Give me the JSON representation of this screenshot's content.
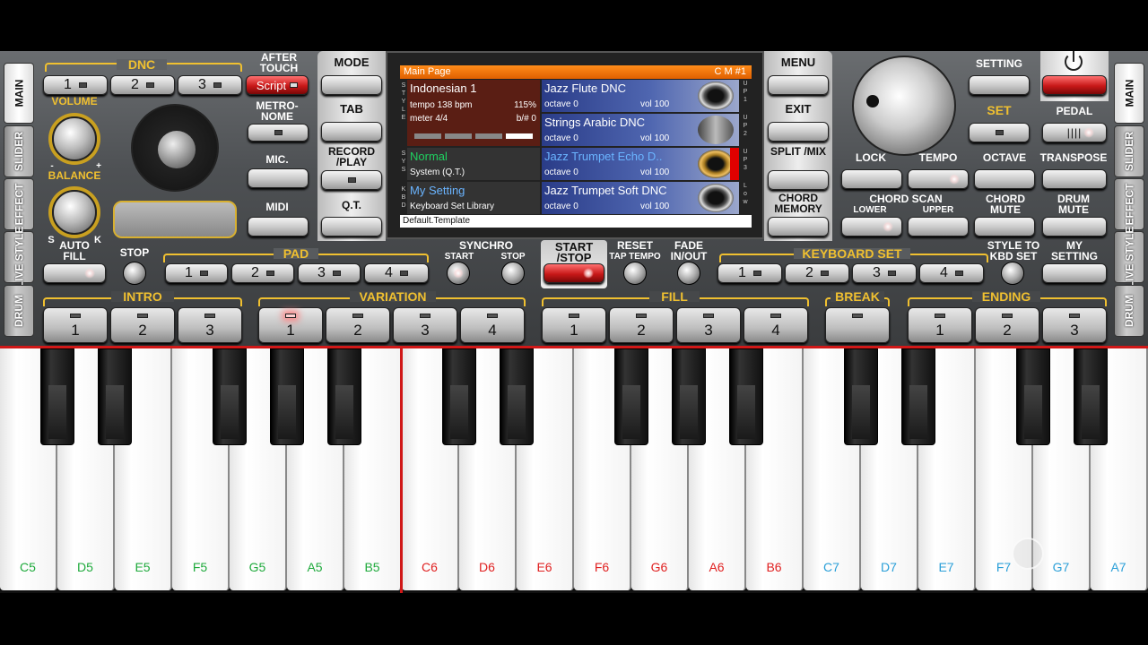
{
  "side_tabs": [
    "MAIN",
    "SLIDER",
    "EFFECT",
    "LIVE STYLE",
    "DRUM"
  ],
  "left": {
    "dnc_label": "DNC",
    "dnc_buttons": [
      "1",
      "2",
      "3"
    ],
    "after_touch": "AFTER TOUCH",
    "script_label": "Script",
    "volume": "VOLUME",
    "balance": "BALANCE",
    "balance_minus": "-",
    "balance_plus": "+",
    "s_label": "S",
    "k_label": "K",
    "metronome": "METRO- NOME",
    "mic": "MIC.",
    "midi": "MIDI",
    "auto_fill": "AUTO FILL",
    "stop": "STOP",
    "pad": "PAD",
    "pad_buttons": [
      "1",
      "2",
      "3",
      "4"
    ],
    "intro": "INTRO",
    "intro_buttons": [
      "1",
      "2",
      "3"
    ],
    "variation": "VARIATION",
    "variation_buttons": [
      "1",
      "2",
      "3",
      "4"
    ]
  },
  "center": {
    "mode": "MODE",
    "tab": "TAB",
    "record_play": "RECORD /PLAY",
    "qt": "Q.T.",
    "menu": "MENU",
    "exit": "EXIT",
    "split_mix": "SPLIT /MIX",
    "chord_memory": "CHORD MEMORY",
    "synchro": "SYNCHRO",
    "synchro_start": "START",
    "synchro_stop": "STOP",
    "start_stop": "START /STOP",
    "reset": "RESET",
    "tap_tempo": "TAP TEMPO",
    "fade": "FADE IN/OUT",
    "fill": "FILL",
    "fill_buttons": [
      "1",
      "2",
      "3",
      "4"
    ],
    "break": "BREAK"
  },
  "screen": {
    "title": "Main Page",
    "cm": "C M #1",
    "style_name": "Indonesian 1",
    "tempo": "tempo 138 bpm",
    "percent": "115%",
    "meter": "meter 4/4",
    "bsharp": "b/# 0",
    "sys_name": "Normal",
    "sys_sub": "System (Q.T.)",
    "kbd_name": "My Setting",
    "kbd_sub": "Keyboard Set Library",
    "footer": "Default.Template",
    "side_left": [
      "S",
      "T",
      "Y",
      "L",
      "E",
      " ",
      "S",
      "Y",
      "S",
      " ",
      "K",
      "B",
      "D"
    ],
    "upper_labels": [
      "U P 1",
      "U P 2",
      "U P 3",
      "L o w"
    ],
    "instruments": [
      {
        "name": "Jazz Flute DNC",
        "octave": "octave  0",
        "vol": "vol 100"
      },
      {
        "name": "Strings Arabic DNC",
        "octave": "octave  0",
        "vol": "vol 100"
      },
      {
        "name": "Jazz Trumpet Echo D..",
        "octave": "octave  0",
        "vol": "vol 100"
      },
      {
        "name": "Jazz Trumpet Soft DNC",
        "octave": "octave  0",
        "vol": "vol 100"
      }
    ]
  },
  "right": {
    "setting": "SETTING",
    "set": "SET",
    "pedal": "PEDAL",
    "lock": "LOCK",
    "tempo": "TEMPO",
    "octave": "OCTAVE",
    "transpose": "TRANSPOSE",
    "chord_scan": "CHORD SCAN",
    "lower": "LOWER",
    "upper": "UPPER",
    "chord_mute": "CHORD MUTE",
    "drum_mute": "DRUM MUTE",
    "keyboard_set": "KEYBOARD SET",
    "kbd_buttons": [
      "1",
      "2",
      "3",
      "4"
    ],
    "style_to_kbd": "STYLE TO KBD SET",
    "my_setting": "MY SETTING",
    "ending": "ENDING",
    "ending_buttons": [
      "1",
      "2",
      "3"
    ]
  },
  "white_keys": [
    "C5",
    "D5",
    "E5",
    "F5",
    "G5",
    "A5",
    "B5",
    "C6",
    "D6",
    "E6",
    "F6",
    "G6",
    "A6",
    "B6",
    "C7",
    "D7",
    "E7",
    "F7",
    "G7",
    "A7"
  ],
  "colors": {
    "green": "#1faa3c",
    "red": "#e02020",
    "blue": "#2a9fd8",
    "accent": "#f0c030"
  }
}
